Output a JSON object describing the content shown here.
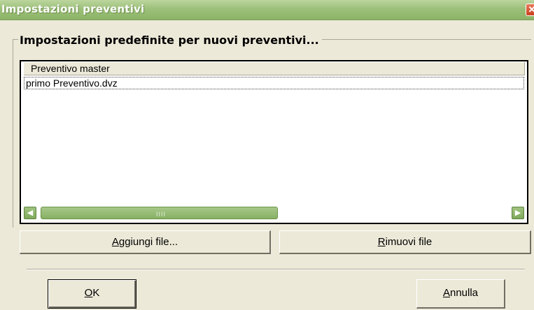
{
  "window": {
    "title": "Impostazioni preventivi",
    "close_glyph": "✕"
  },
  "group": {
    "title": "Impostazioni predefinite per nuovi preventivi..."
  },
  "list": {
    "column_header": "Preventivo master",
    "rows": [
      {
        "label": "primo Preventivo.dvz"
      }
    ]
  },
  "scrollbar": {
    "left_arrow": "◀",
    "right_arrow": "▶",
    "grip": "IIII"
  },
  "buttons": {
    "add_first": "A",
    "add_rest": "ggiungi file...",
    "remove_first": "R",
    "remove_rest": "imuovi file",
    "ok_first": "O",
    "ok_rest": "K",
    "cancel_first": "A",
    "cancel_rest": "nnulla"
  }
}
